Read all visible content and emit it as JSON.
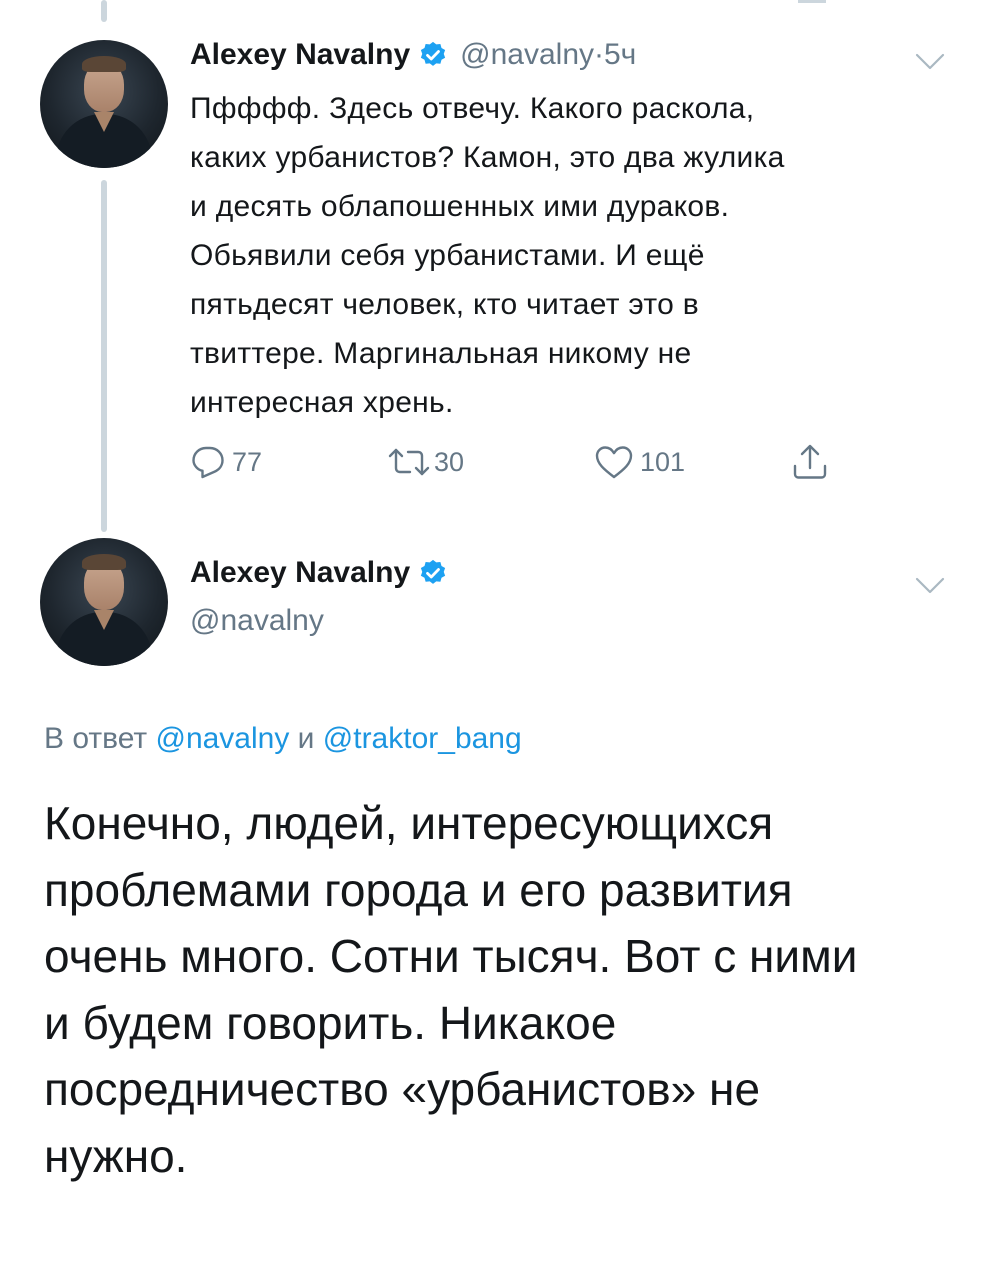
{
  "tweet1": {
    "author_name": "Alexey Navalny",
    "handle": "@navalny",
    "separator": " · ",
    "time": "5ч",
    "text_lines": [
      "Пфффф. Здесь отвечу. Какого раскола,",
      "каких урбанистов? Камон, это два жулика",
      "и десять облапошенных ими дураков.",
      "Обьявили себя урбанистами. И ещё",
      "пятьдесят человек, кто читает это в",
      "твиттере. Маргинальная никому не",
      "интересная хрень."
    ],
    "reply_count": "77",
    "retweet_count": "30",
    "like_count": "101",
    "icons": [
      "reply-icon",
      "retweet-icon",
      "like-icon",
      "share-icon",
      "verified-icon",
      "chevron-down-icon"
    ]
  },
  "tweet2": {
    "author_name": "Alexey Navalny",
    "handle": "@navalny",
    "reply_prefix": "В ответ ",
    "reply_user1": "@navalny",
    "reply_joiner": " и ",
    "reply_user2": "@traktor_bang",
    "text_lines": [
      "Конечно, людей, интересующихся",
      "проблемами города и его развития",
      "очень много. Сотни тысяч. Вот с ними",
      "и будем говорить. Никакое",
      "посредничество «урбанистов» не",
      "нужно."
    ]
  },
  "colors": {
    "verified": "#1da1f2",
    "muted": "#657786",
    "link": "#1b95e0",
    "thread_line": "#ccd6dd",
    "text": "#14171a"
  }
}
